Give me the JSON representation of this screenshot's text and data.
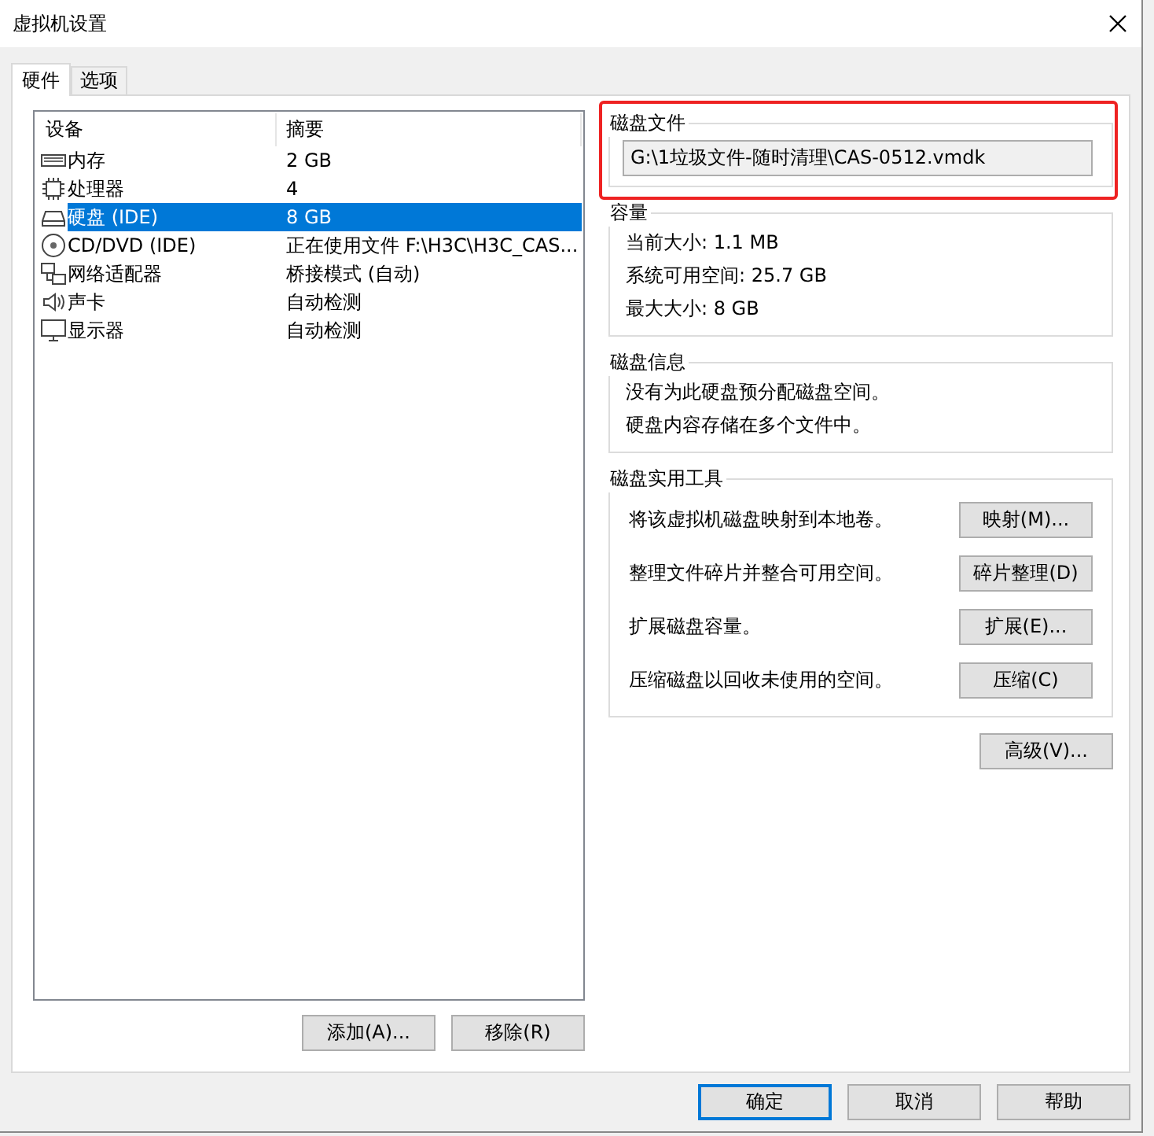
{
  "window": {
    "title": "虚拟机设置"
  },
  "tabs": [
    {
      "label": "硬件",
      "selected": true
    },
    {
      "label": "选项",
      "selected": false
    }
  ],
  "device_table": {
    "columns": [
      "设备",
      "摘要"
    ],
    "rows": [
      {
        "kind": "memory",
        "device": "内存",
        "summary": "2 GB",
        "selected": false
      },
      {
        "kind": "cpu",
        "device": "处理器",
        "summary": "4",
        "selected": false
      },
      {
        "kind": "disk",
        "device": "硬盘 (IDE)",
        "summary": "8 GB",
        "selected": true
      },
      {
        "kind": "cd",
        "device": "CD/DVD (IDE)",
        "summary": "正在使用文件 F:\\H3C\\H3C_CAS...",
        "selected": false
      },
      {
        "kind": "network",
        "device": "网络适配器",
        "summary": "桥接模式 (自动)",
        "selected": false
      },
      {
        "kind": "sound",
        "device": "声卡",
        "summary": "自动检测",
        "selected": false
      },
      {
        "kind": "display",
        "device": "显示器",
        "summary": "自动检测",
        "selected": false
      }
    ]
  },
  "list_buttons": [
    "添加(A)...",
    "移除(R)"
  ],
  "disk_file": {
    "title": "磁盘文件",
    "value": "G:\\1垃圾文件-随时清理\\CAS-0512.vmdk",
    "highlighted": true
  },
  "capacity": {
    "title": "容量",
    "lines": [
      "当前大小: 1.1 MB",
      "系统可用空间: 25.7 GB",
      "最大大小: 8 GB"
    ]
  },
  "disk_info": {
    "title": "磁盘信息",
    "lines": [
      "没有为此硬盘预分配磁盘空间。",
      "硬盘内容存储在多个文件中。"
    ]
  },
  "utilities": {
    "title": "磁盘实用工具",
    "rows": [
      {
        "description": "将该虚拟机磁盘映射到本地卷。",
        "button": "映射(M)..."
      },
      {
        "description": "整理文件碎片并整合可用空间。",
        "button": "碎片整理(D)"
      },
      {
        "description": "扩展磁盘容量。",
        "button": "扩展(E)..."
      },
      {
        "description": "压缩磁盘以回收未使用的空间。",
        "button": "压缩(C)"
      }
    ]
  },
  "advanced_button": "高级(V)...",
  "dialog_buttons": [
    {
      "label": "确定",
      "default": true
    },
    {
      "label": "取消",
      "default": false
    },
    {
      "label": "帮助",
      "default": false
    }
  ]
}
